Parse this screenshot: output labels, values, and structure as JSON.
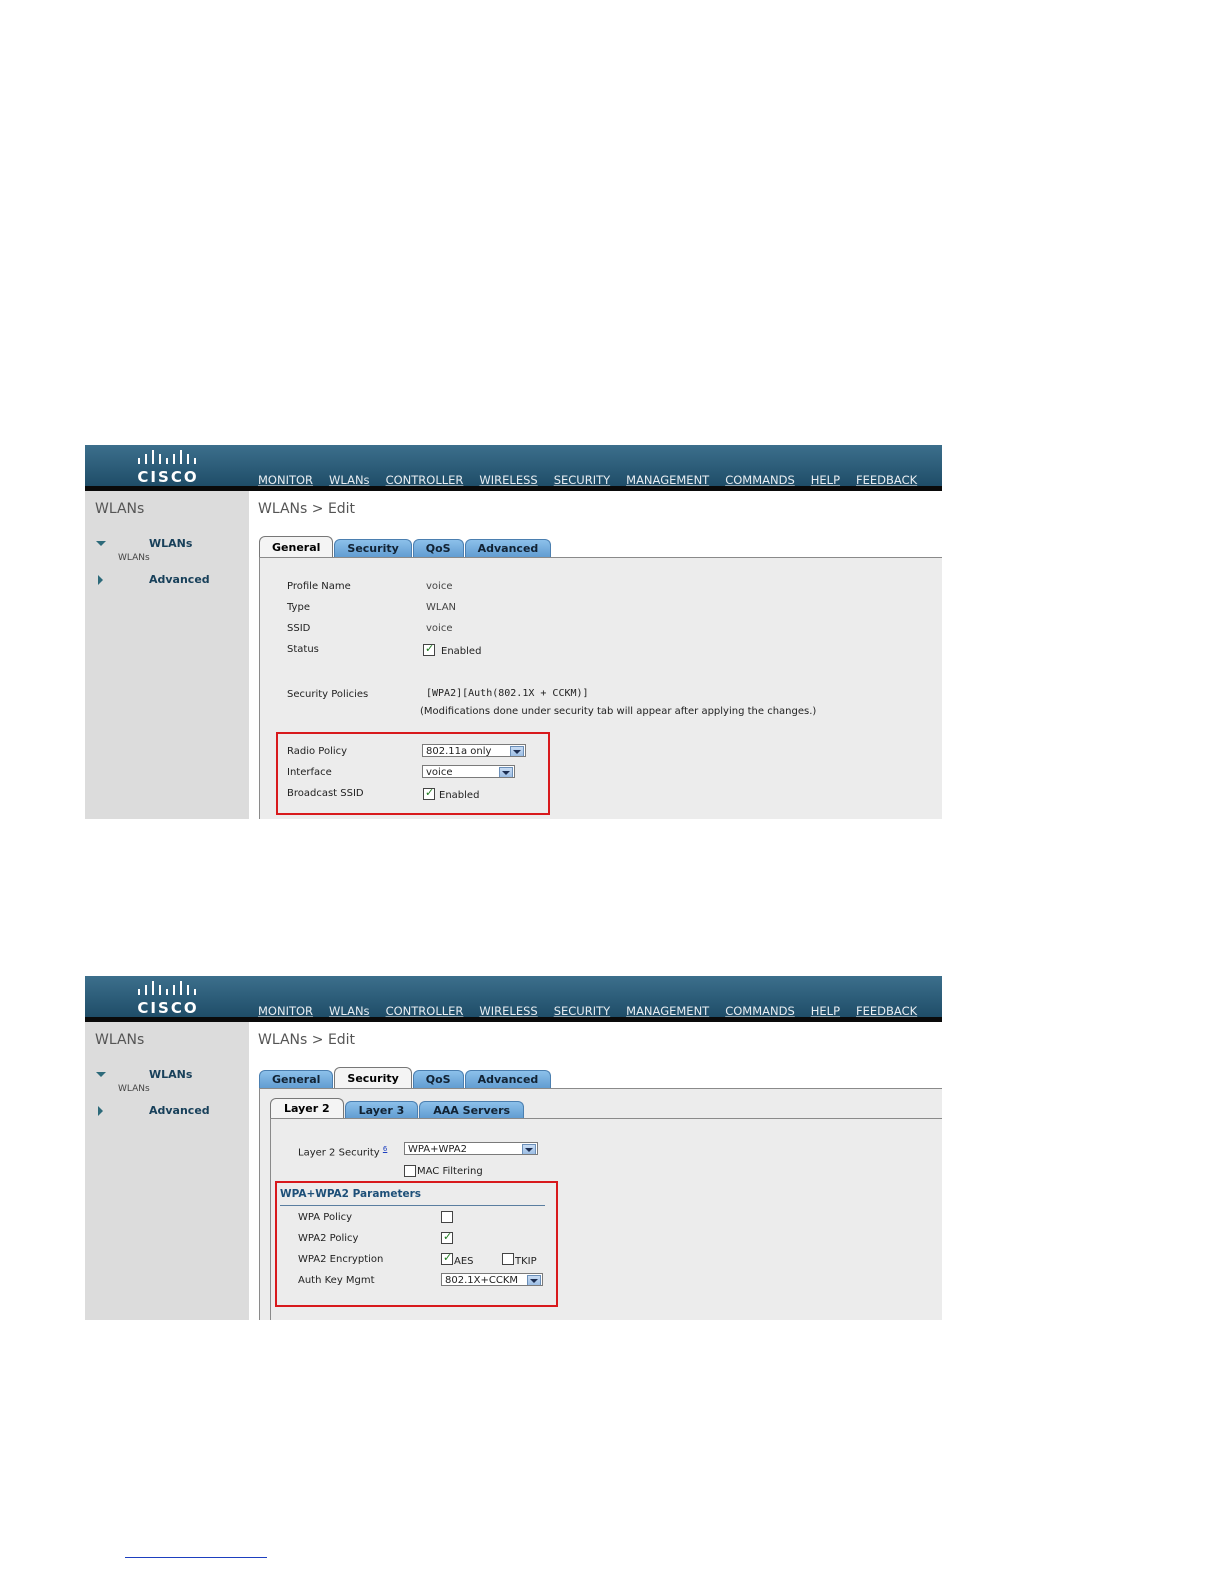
{
  "brand": "CISCO",
  "nav": [
    "MONITOR",
    "WLANs",
    "CONTROLLER",
    "WIRELESS",
    "SECURITY",
    "MANAGEMENT",
    "COMMANDS",
    "HELP",
    "FEEDBACK"
  ],
  "nav_active": "WLANs",
  "sidebar": {
    "title": "WLANs",
    "wlans_link": "WLANs",
    "wlans_sub": "WLANs",
    "advanced_link": "Advanced"
  },
  "breadcrumb": "WLANs > Edit",
  "tabs": [
    "General",
    "Security",
    "QoS",
    "Advanced"
  ],
  "screen1": {
    "active_tab": "General",
    "rows": {
      "profile_name_label": "Profile Name",
      "profile_name_value": "voice",
      "type_label": "Type",
      "type_value": "WLAN",
      "ssid_label": "SSID",
      "ssid_value": "voice",
      "status_label": "Status",
      "status_value": "Enabled",
      "status_checked": true,
      "security_policies_label": "Security Policies",
      "security_policies_value": "[WPA2][Auth(802.1X + CCKM)]",
      "security_policies_note": "(Modifications done under security tab will appear after applying the changes.)",
      "radio_policy_label": "Radio Policy",
      "radio_policy_value": "802.11a only",
      "interface_label": "Interface",
      "interface_value": "voice",
      "broadcast_ssid_label": "Broadcast SSID",
      "broadcast_ssid_value": "Enabled",
      "broadcast_ssid_checked": true
    }
  },
  "screen2": {
    "active_tab": "Security",
    "subtabs": [
      "Layer 2",
      "Layer 3",
      "AAA Servers"
    ],
    "active_subtab": "Layer 2",
    "layer2_security_label": "Layer 2 Security",
    "layer2_security_footnote": "6",
    "layer2_security_value": "WPA+WPA2",
    "mac_filtering_label": "MAC Filtering",
    "mac_filtering_checked": false,
    "params_title": "WPA+WPA2 Parameters",
    "wpa_policy_label": "WPA Policy",
    "wpa_policy_checked": false,
    "wpa2_policy_label": "WPA2 Policy",
    "wpa2_policy_checked": true,
    "wpa2_encryption_label": "WPA2 Encryption",
    "aes_label": "AES",
    "aes_checked": true,
    "tkip_label": "TKIP",
    "tkip_checked": false,
    "auth_key_mgmt_label": "Auth Key Mgmt",
    "auth_key_mgmt_value": "802.1X+CCKM"
  }
}
